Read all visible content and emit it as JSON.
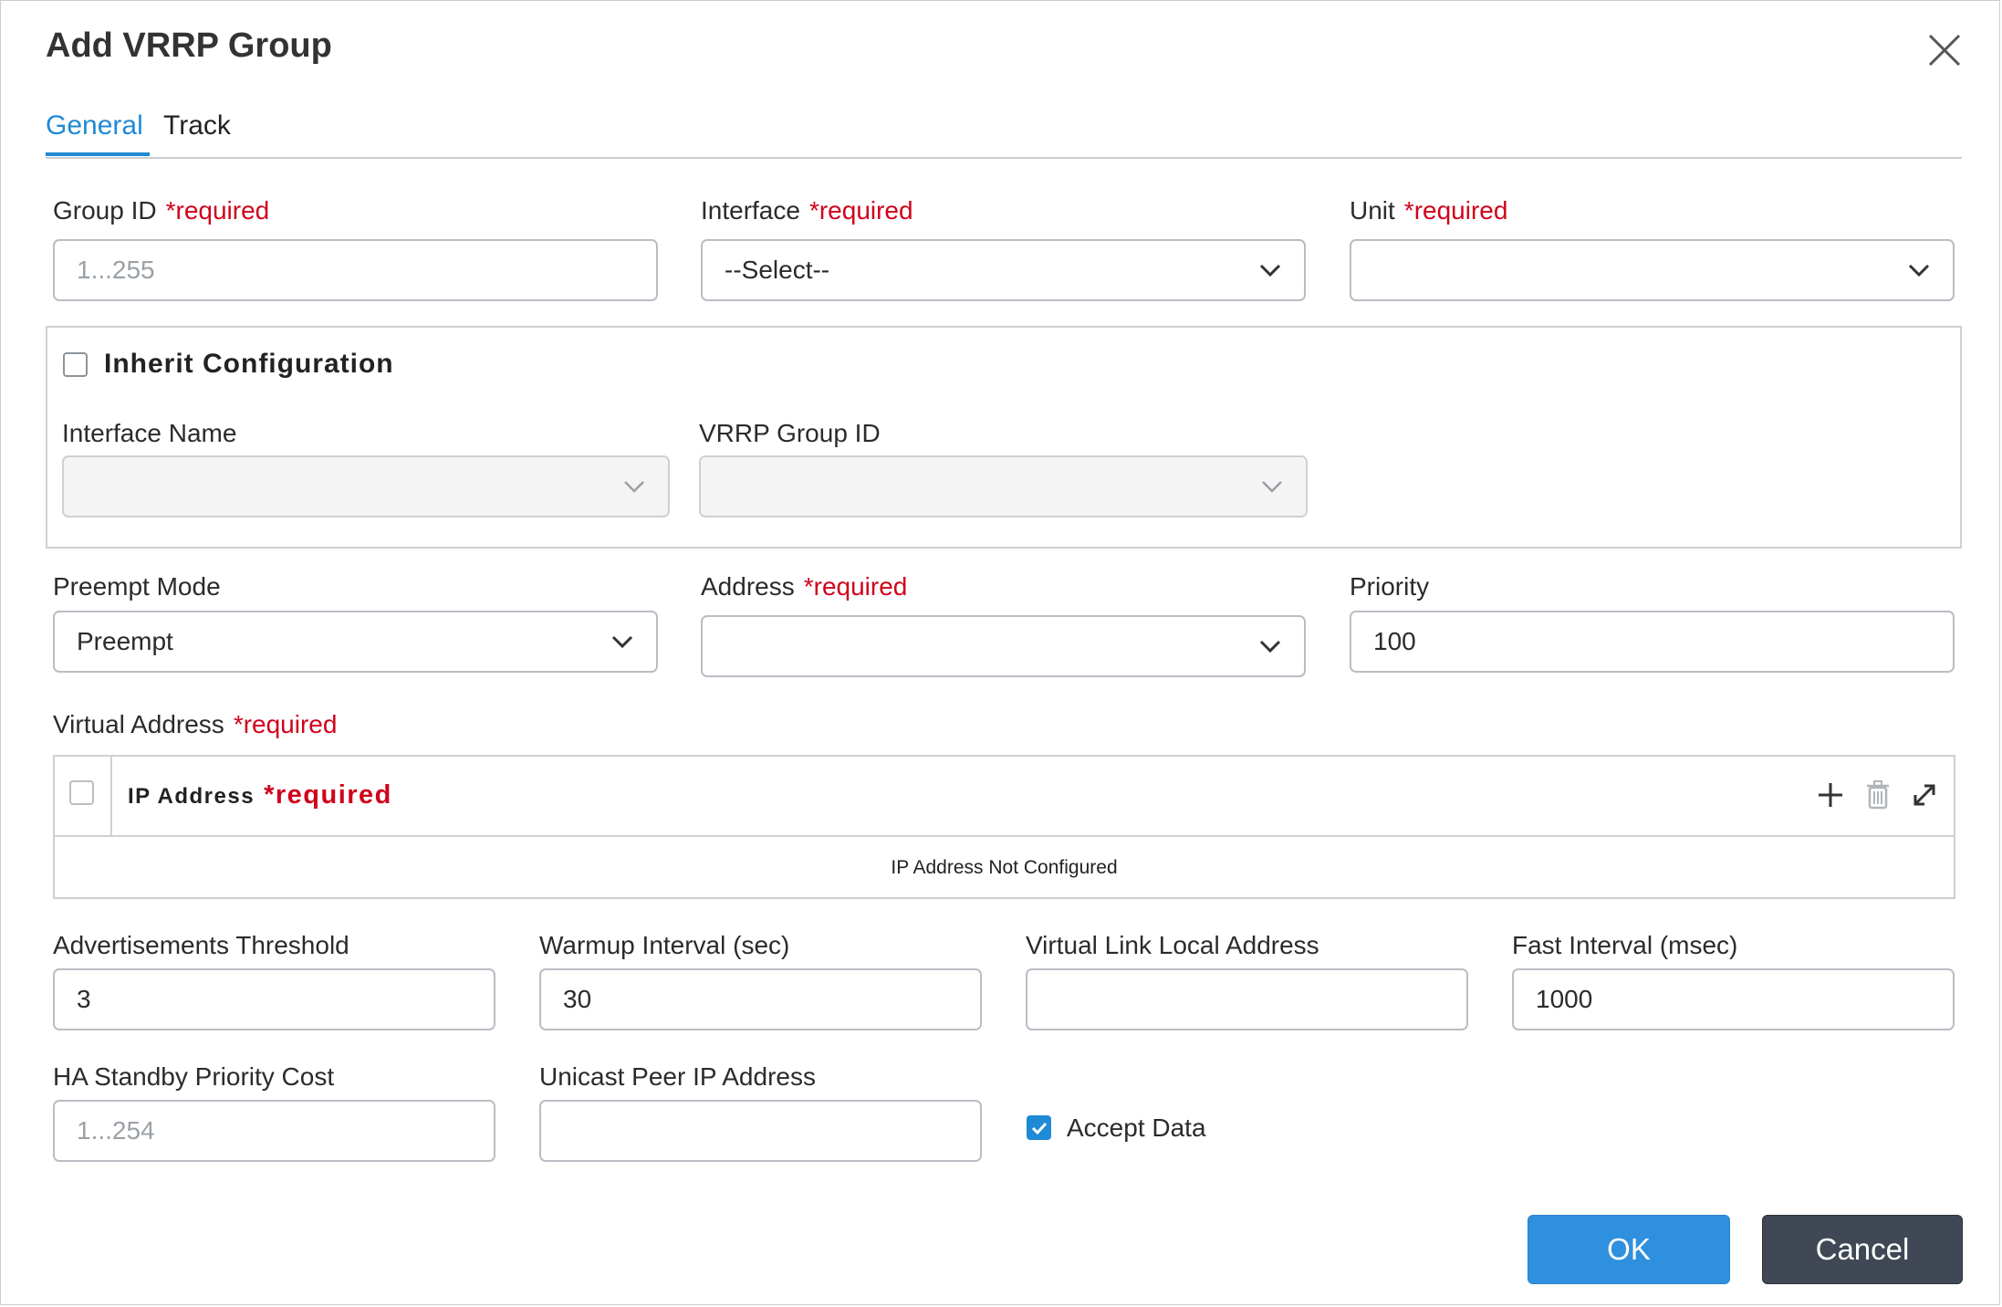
{
  "dialog": {
    "title": "Add VRRP Group"
  },
  "tabs": [
    {
      "label": "General",
      "active": true
    },
    {
      "label": "Track",
      "active": false
    }
  ],
  "required_marker": "*required",
  "fields": {
    "group_id": {
      "label": "Group ID",
      "placeholder": "1...255",
      "value": ""
    },
    "interface": {
      "label": "Interface",
      "value": "--Select--"
    },
    "unit": {
      "label": "Unit",
      "value": ""
    },
    "inherit": {
      "label": "Inherit Configuration",
      "checked": false,
      "interface_name": {
        "label": "Interface Name",
        "value": ""
      },
      "vrrp_group_id": {
        "label": "VRRP Group ID",
        "value": ""
      }
    },
    "preempt_mode": {
      "label": "Preempt Mode",
      "value": "Preempt"
    },
    "address": {
      "label": "Address",
      "value": ""
    },
    "priority": {
      "label": "Priority",
      "value": "100"
    },
    "virtual_address": {
      "label": "Virtual Address",
      "column": "IP Address",
      "empty_text": "IP Address Not Configured"
    },
    "advertisements_threshold": {
      "label": "Advertisements Threshold",
      "value": "3"
    },
    "warmup_interval": {
      "label": "Warmup Interval (sec)",
      "value": "30"
    },
    "virtual_link_local": {
      "label": "Virtual Link Local Address",
      "value": ""
    },
    "fast_interval": {
      "label": "Fast Interval (msec)",
      "value": "1000"
    },
    "ha_standby_cost": {
      "label": "HA Standby Priority Cost",
      "placeholder": "1...254",
      "value": ""
    },
    "unicast_peer": {
      "label": "Unicast Peer IP Address",
      "value": ""
    },
    "accept_data": {
      "label": "Accept Data",
      "checked": true
    }
  },
  "buttons": {
    "ok": "OK",
    "cancel": "Cancel"
  },
  "colors": {
    "accent": "#1f8ad6",
    "required": "#d0021b",
    "ok_button": "#2f90df",
    "cancel_button": "#3f4854"
  },
  "icons": {
    "close": "close-icon",
    "dropdown": "chevron-down-icon",
    "add": "plus-icon",
    "delete": "trash-icon",
    "expand": "expand-icon",
    "check": "checkmark-icon"
  }
}
